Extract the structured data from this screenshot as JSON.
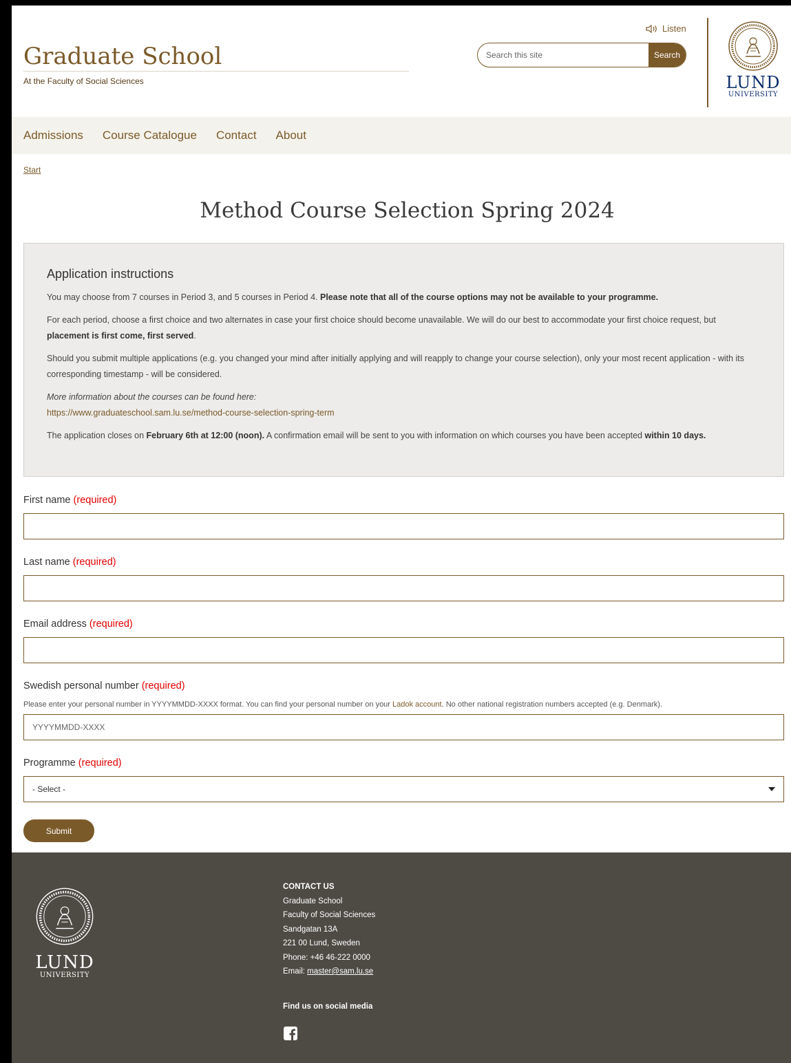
{
  "header": {
    "title": "Graduate School",
    "subtitle": "At the Faculty of Social Sciences",
    "listen_label": "Listen",
    "search_placeholder": "Search this site",
    "search_button": "Search",
    "logo_name": "LUND",
    "logo_sub": "UNIVERSITY"
  },
  "nav": {
    "items": [
      "Admissions",
      "Course Catalogue",
      "Contact",
      "About"
    ]
  },
  "breadcrumb": {
    "start": "Start"
  },
  "page_title": "Method Course Selection Spring 2024",
  "instructions": {
    "heading": "Application instructions",
    "p1_text": "You may choose from 7 courses in Period 3, and 5 courses in Period 4. ",
    "p1_bold": "Please note that all of the course options may not be available to your programme.",
    "p2_text": "For each period, choose a first choice and two alternates in case your first choice should become unavailable. We will do our best to accommodate your first choice request, but ",
    "p2_bold": "placement is first come, first served",
    "p2_end": ".",
    "p3": "Should you submit multiple applications (e.g. you changed your mind after initially applying and will reapply to change your course selection), only your most recent application - with its corresponding timestamp - will be considered.",
    "p4_italic": "More information about the courses can be found here:",
    "p4_link": "https://www.graduateschool.sam.lu.se/method-course-selection-spring-term",
    "p5_text": "The application closes on ",
    "p5_bold1": "February 6th at 12:00 (noon).",
    "p5_mid": " A confirmation email will be sent to you with information on which courses you have been accepted ",
    "p5_bold2": "within 10 days."
  },
  "form": {
    "required_marker": "(required)",
    "first_name_label": "First name",
    "last_name_label": "Last name",
    "email_label": "Email address",
    "personal_number_label": "Swedish personal number",
    "personal_help_pre": "Please enter your personal number in YYYYMMDD-XXXX format. You can find your personal number on your ",
    "personal_help_link": "Ladok account",
    "personal_help_post": ". No other national registration numbers accepted (e.g. Denmark).",
    "personal_placeholder": "YYYYMMDD-XXXX",
    "programme_label": "Programme",
    "programme_selected": "- Select -",
    "submit_label": "Submit"
  },
  "footer": {
    "logo_name": "LUND",
    "logo_sub": "UNIVERSITY",
    "contact_title": "CONTACT US",
    "contact_lines": [
      "Graduate School",
      "Faculty of Social Sciences",
      "Sandgatan 13A",
      "221 00 Lund, Sweden",
      "Phone: +46 46-222 0000"
    ],
    "email_prefix": "Email: ",
    "email": "master@sam.lu.se",
    "social_title": "Find us on social media"
  },
  "colors": {
    "brand_brown": "#7b5a2a",
    "lund_blue": "#0a2c6b",
    "footer_bg": "#4d4b44",
    "required_red": "#e10000"
  }
}
